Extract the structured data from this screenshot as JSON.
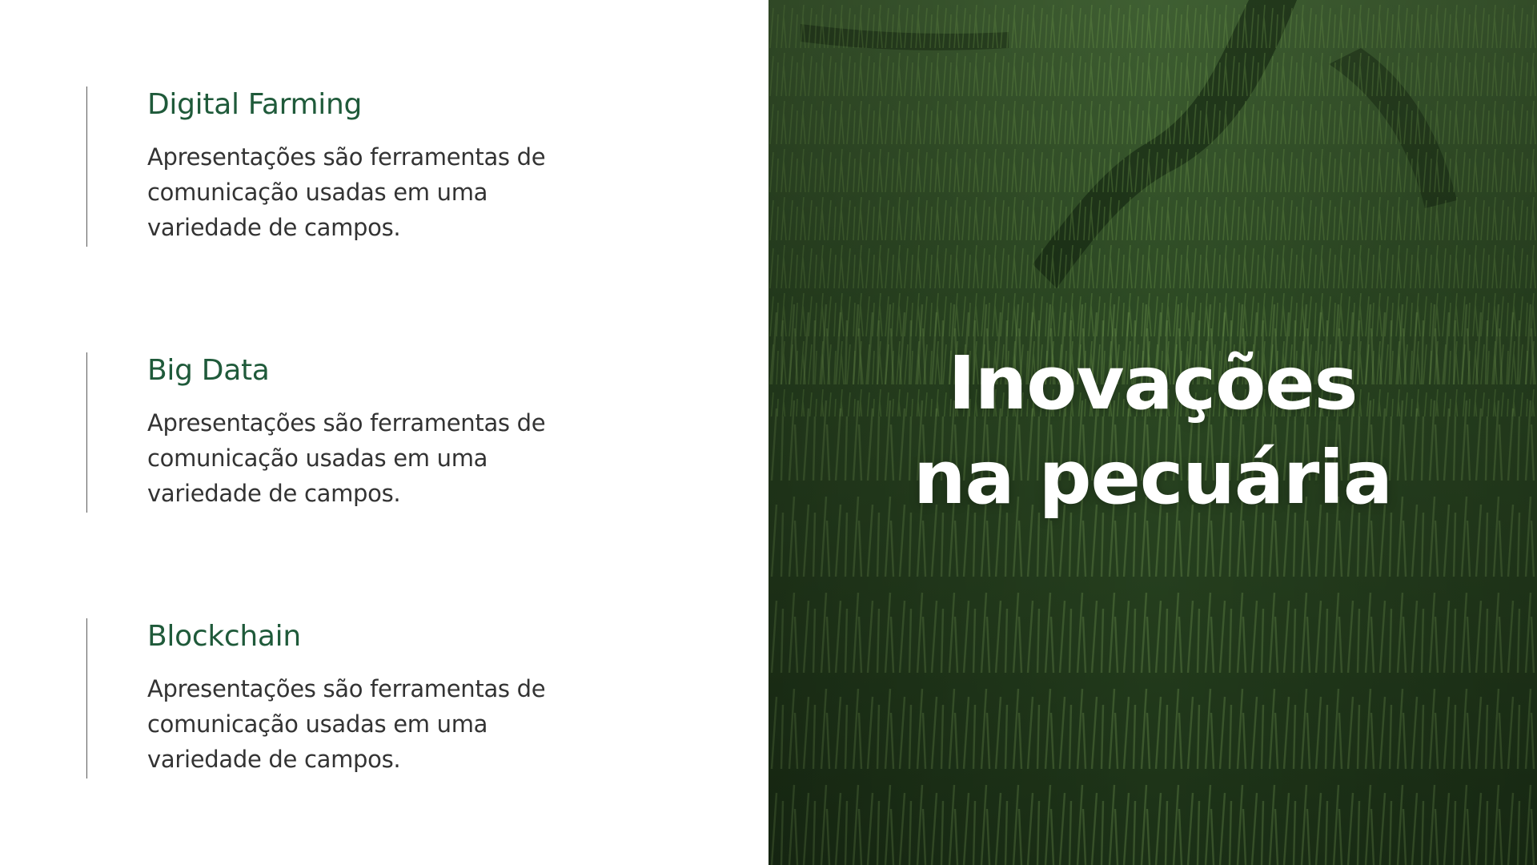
{
  "features": [
    {
      "title": "Digital Farming",
      "text": "Apresentações são ferramentas de comunicação usadas em uma variedade de campos."
    },
    {
      "title": "Big Data",
      "text": "Apresentações são ferramentas de comunicação usadas em uma variedade de campos."
    },
    {
      "title": "Blockchain",
      "text": "Apresentações são ferramentas de comunicação usadas em uma variedade de campos."
    }
  ],
  "hero": {
    "line1": "Inovações",
    "line2": "na pecuária"
  },
  "colors": {
    "heading_green": "#1f5a3a",
    "body_text": "#333333",
    "photo_dark_green": "#1d3a1a",
    "photo_light_green": "#6e9a4a"
  }
}
